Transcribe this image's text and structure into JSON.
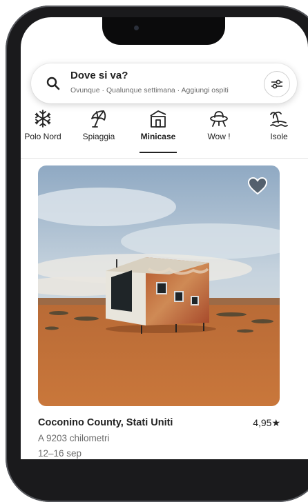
{
  "search": {
    "title": "Dove si va?",
    "subtitle": "Ovunque · Qualunque settimana · Aggiungi ospiti"
  },
  "categories": [
    {
      "label": "Polo Nord",
      "icon": "snowflake-icon"
    },
    {
      "label": "Spiaggia",
      "icon": "umbrella-icon"
    },
    {
      "label": "Minicase",
      "icon": "tiny-house-icon"
    },
    {
      "label": "Wow !",
      "icon": "ufo-icon"
    },
    {
      "label": "Isole",
      "icon": "island-icon"
    }
  ],
  "selected_category": "Minicase",
  "listing": {
    "title": "Coconino County, Stati Uniti",
    "rating": "4,95",
    "distance": "A 9203 chilometri",
    "dates": "12–16 sep"
  }
}
